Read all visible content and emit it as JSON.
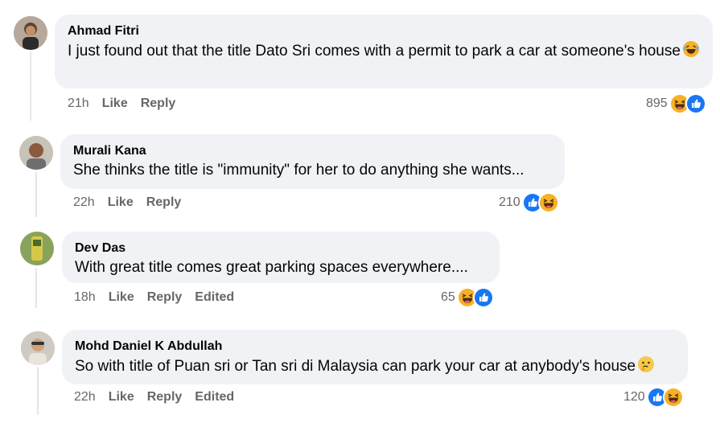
{
  "colors": {
    "bubble_bg": "#f0f2f5",
    "meta_text": "#65676b",
    "like_blue": "#1877f2",
    "haha_yellow": "#f7b125"
  },
  "comments": [
    {
      "author": "Ahmad Fitri",
      "text": "I just found out that the title Dato Sri comes with a permit to park a car at someone's house",
      "inline_emoji": "haha-emoji-icon",
      "time": "21h",
      "like": "Like",
      "reply": "Reply",
      "edited": "",
      "reaction_count": "895",
      "reactions": [
        "haha-icon",
        "like-icon"
      ]
    },
    {
      "author": "Murali Kana",
      "text": "She thinks the title is \"immunity\" for her to do anything she wants...",
      "inline_emoji": "",
      "time": "22h",
      "like": "Like",
      "reply": "Reply",
      "edited": "",
      "reaction_count": "210",
      "reactions": [
        "like-icon",
        "haha-icon"
      ]
    },
    {
      "author": "Dev Das",
      "text": "With great title comes great parking spaces everywhere....",
      "inline_emoji": "",
      "time": "18h",
      "like": "Like",
      "reply": "Reply",
      "edited": "Edited",
      "reaction_count": "65",
      "reactions": [
        "haha-icon",
        "like-icon"
      ]
    },
    {
      "author": "Mohd Daniel K Abdullah",
      "text": "So with title of Puan sri or Tan sri di Malaysia can park your car at anybody's house",
      "inline_emoji": "thinking-emoji-icon",
      "time": "22h",
      "like": "Like",
      "reply": "Reply",
      "edited": "Edited",
      "reaction_count": "120",
      "reactions": [
        "like-icon",
        "haha-icon"
      ]
    }
  ]
}
